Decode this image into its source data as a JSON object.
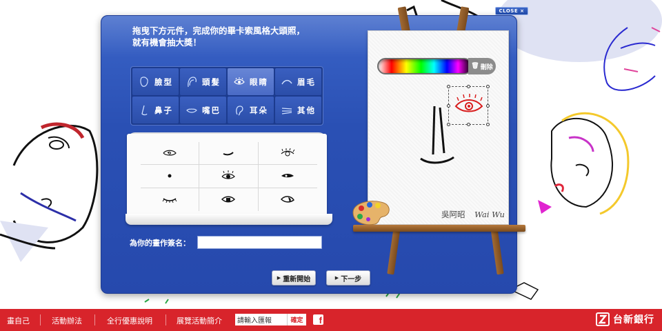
{
  "dialog": {
    "close_label": "CLOSE",
    "close_icon": "×",
    "instruction_line1": "拖曳下方元件，完成你的畢卡索風格大頭照，",
    "instruction_line2": "就有機會抽大獎！"
  },
  "categories": [
    {
      "label": "臉型",
      "icon": "face-shape-icon",
      "active": false
    },
    {
      "label": "頭髮",
      "icon": "hair-icon",
      "active": false
    },
    {
      "label": "眼睛",
      "icon": "eye-icon",
      "active": true
    },
    {
      "label": "眉毛",
      "icon": "eyebrow-icon",
      "active": false
    },
    {
      "label": "鼻子",
      "icon": "nose-icon",
      "active": false
    },
    {
      "label": "嘴巴",
      "icon": "mouth-icon",
      "active": false
    },
    {
      "label": "耳朵",
      "icon": "ear-icon",
      "active": false
    },
    {
      "label": "其他",
      "icon": "other-icon",
      "active": false
    }
  ],
  "parts": [
    "eye-part-1",
    "eye-part-2",
    "eye-part-3",
    "eye-part-4",
    "eye-part-5",
    "eye-part-6",
    "eye-part-7",
    "eye-part-8",
    "eye-part-9"
  ],
  "signature_form": {
    "label": "為你的畫作簽名：",
    "value": ""
  },
  "buttons": {
    "restart": "重新開始",
    "next": "下一步"
  },
  "canvas": {
    "delete_label": "刪除",
    "signature_zh": "吳阿昭",
    "signature_en": "Wai Wu"
  },
  "footer": {
    "nav": [
      "畫自己",
      "活動辦法",
      "全行優惠說明",
      "展覽活動簡介"
    ],
    "search_placeholder": "請輸入匯報",
    "search_button": "確定",
    "facebook_icon": "f",
    "bank_name": "台新銀行"
  },
  "colors": {
    "dialog_blue": "#2a50b4",
    "footer_red": "#d8242b"
  }
}
